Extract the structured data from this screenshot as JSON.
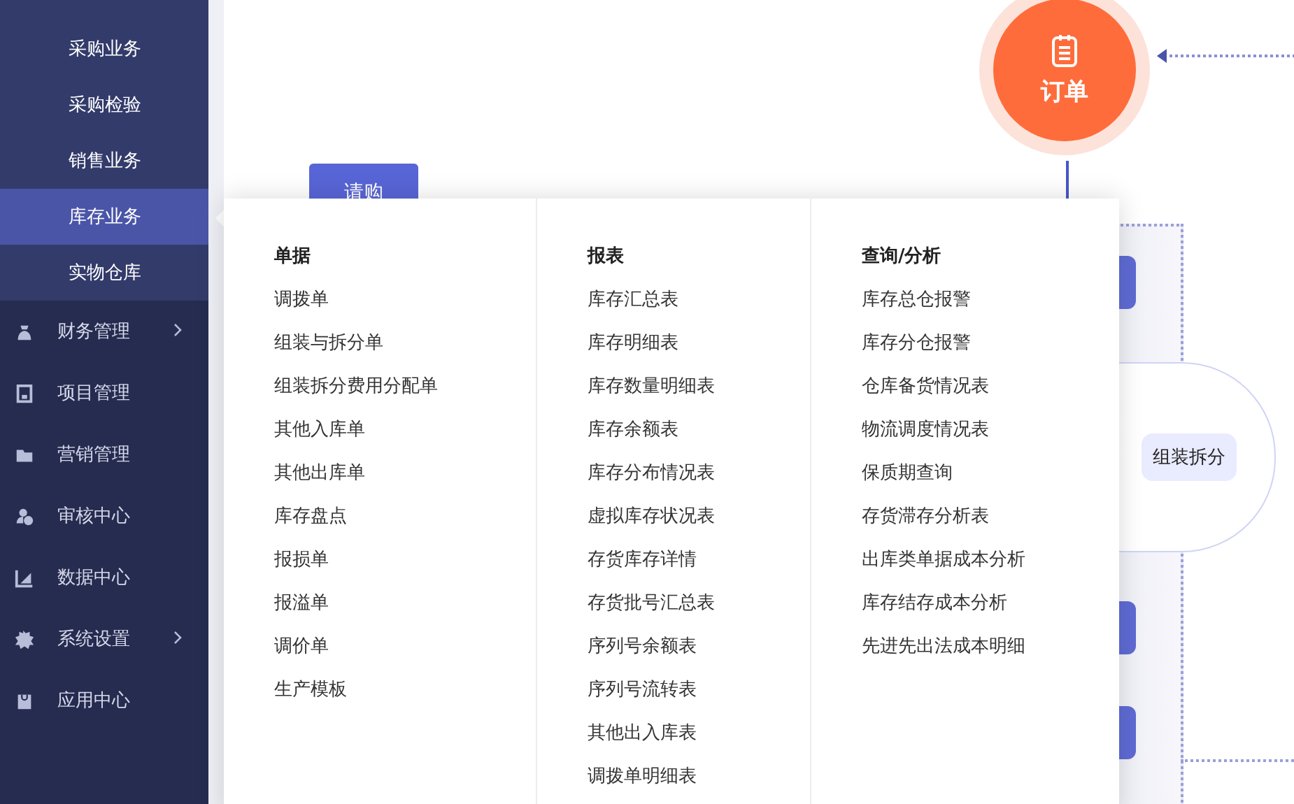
{
  "sidebar": {
    "sub_items": [
      {
        "label": "采购业务",
        "selected": false
      },
      {
        "label": "采购检验",
        "selected": false
      },
      {
        "label": "销售业务",
        "selected": false
      },
      {
        "label": "库存业务",
        "selected": true
      },
      {
        "label": "实物仓库",
        "selected": false
      }
    ],
    "items": [
      {
        "label": "财务管理",
        "expandable": true
      },
      {
        "label": "项目管理",
        "expandable": false
      },
      {
        "label": "营销管理",
        "expandable": false
      },
      {
        "label": "审核中心",
        "expandable": false
      },
      {
        "label": "数据中心",
        "expandable": false
      },
      {
        "label": "系统设置",
        "expandable": true
      },
      {
        "label": "应用中心",
        "expandable": false
      }
    ]
  },
  "canvas": {
    "order_node": "订单",
    "request_button": "请购",
    "assembly_node": "组装拆分"
  },
  "menu": {
    "columns": [
      {
        "title": "单据",
        "items": [
          "调拨单",
          "组装与拆分单",
          "组装拆分费用分配单",
          "其他入库单",
          "其他出库单",
          "库存盘点",
          "报损单",
          "报溢单",
          "调价单",
          "生产模板"
        ]
      },
      {
        "title": "报表",
        "items": [
          "库存汇总表",
          "库存明细表",
          "库存数量明细表",
          "库存余额表",
          "库存分布情况表",
          "虚拟库存状况表",
          "存货库存详情",
          "存货批号汇总表",
          "序列号余额表",
          "序列号流转表",
          "其他出入库表",
          "调拨单明细表"
        ]
      },
      {
        "title": "查询/分析",
        "items": [
          "库存总仓报警",
          "库存分仓报警",
          "仓库备货情况表",
          "物流调度情况表",
          "保质期查询",
          "存货滞存分析表",
          "出库类单据成本分析",
          "库存结存成本分析",
          "先进先出法成本明细"
        ]
      }
    ]
  }
}
